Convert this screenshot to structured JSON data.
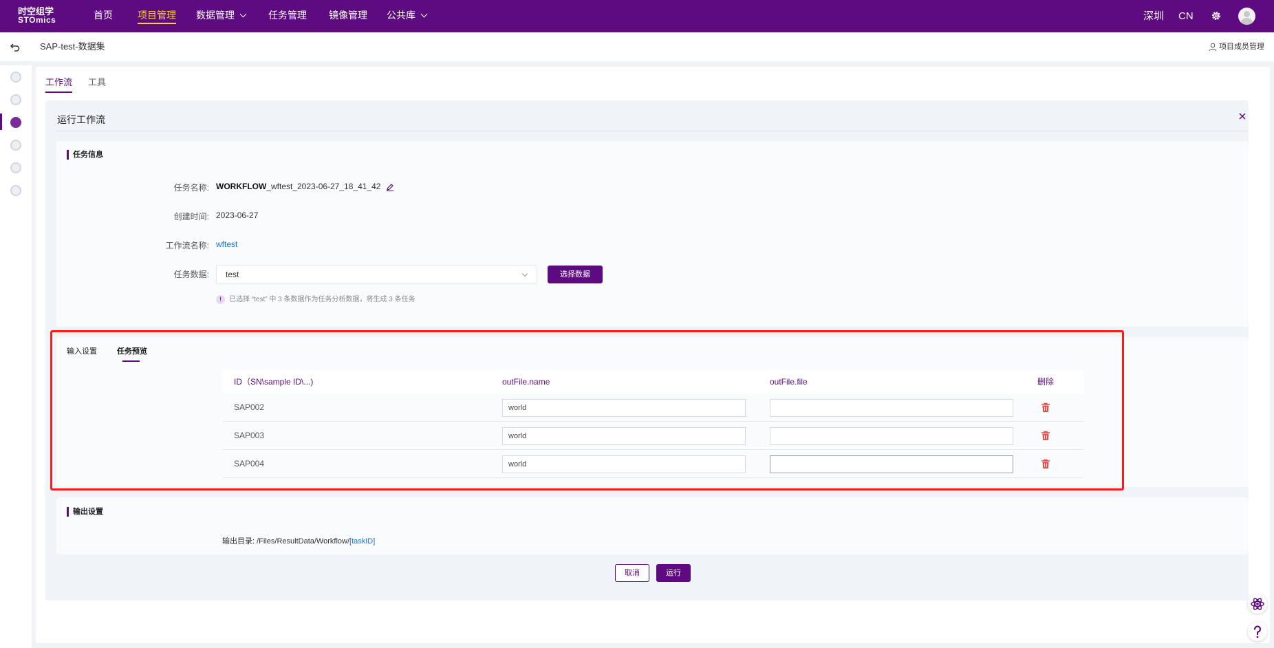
{
  "brand": {
    "line1": "时空组学",
    "line2": "STOmics"
  },
  "nav": {
    "items": [
      {
        "label": "首页"
      },
      {
        "label": "项目管理"
      },
      {
        "label": "数据管理"
      },
      {
        "label": "任务管理"
      },
      {
        "label": "镜像管理"
      },
      {
        "label": "公共库"
      }
    ],
    "region": "深圳",
    "lang": "CN"
  },
  "subheader": {
    "title": "SAP-test-数据集",
    "members": "项目成员管理"
  },
  "tabs": [
    {
      "label": "工作流"
    },
    {
      "label": "工具"
    }
  ],
  "panel": {
    "title": "运行工作流",
    "task_info": {
      "heading": "任务信息",
      "name_label": "任务名称:",
      "name_prefix": "WORKFLOW",
      "name_rest": "_wftest_2023-06-27_18_41_42",
      "created_label": "创建时间:",
      "created_value": "2023-06-27",
      "workflow_label": "工作流名称:",
      "workflow_value": "wftest",
      "data_label": "任务数据:",
      "data_value": "test",
      "select_button": "选择数据",
      "hint": "已选择 “test” 中 3 条数据作为任务分析数据，将生成 3 条任务",
      "hint_icon": "!"
    },
    "subtabs": [
      {
        "label": "输入设置"
      },
      {
        "label": "任务预览"
      }
    ],
    "table": {
      "headers": [
        "ID（SN\\sample ID\\...)",
        "outFile.name",
        "outFile.file",
        "删除"
      ],
      "rows": [
        {
          "id": "SAP002",
          "name": "world",
          "file": ""
        },
        {
          "id": "SAP003",
          "name": "world",
          "file": ""
        },
        {
          "id": "SAP004",
          "name": "world",
          "file": ""
        }
      ]
    },
    "output": {
      "heading": "输出设置",
      "dir_label": "输出目录:",
      "dir_path": "/Files/ResultData/Workflow/",
      "dir_var": "[taskID]"
    },
    "cancel": "取消",
    "run": "运行"
  },
  "colors": {
    "primary": "#5e0a80",
    "accent": "#ffd21f",
    "highlight": "#ff1a1a",
    "link": "#1a6fe6",
    "danger": "#e84c4c"
  }
}
